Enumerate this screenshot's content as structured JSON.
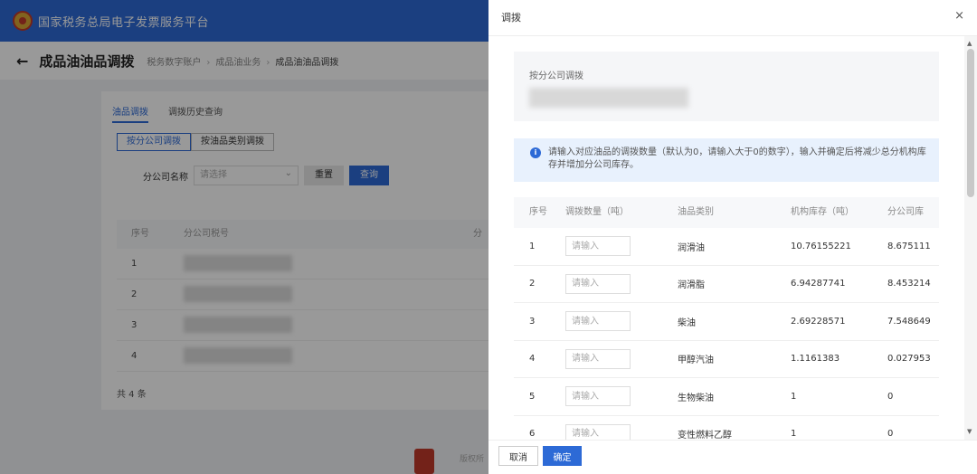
{
  "site": {
    "title": "国家税务总局电子发票服务平台"
  },
  "page": {
    "title": "成品油油品调拨",
    "breadcrumb": [
      "税务数字账户",
      "成品油业务",
      "成品油油品调拨"
    ]
  },
  "tabs": [
    "油品调拨",
    "调拨历史查询"
  ],
  "segments": [
    "按分公司调拨",
    "按油品类别调拨"
  ],
  "filter": {
    "label": "分公司名称",
    "placeholder": "请选择",
    "reset_label": "重置",
    "query_label": "查询"
  },
  "bg_table": {
    "headers": [
      "序号",
      "分公司税号",
      "分"
    ],
    "rows": [
      "1",
      "2",
      "3",
      "4"
    ],
    "total": "共 4 条"
  },
  "footer": {
    "text": "版权所"
  },
  "drawer": {
    "title": "调拨",
    "close": "×",
    "info_label": "按分公司调拨",
    "notice": "请输入对应油品的调拨数量（默认为0，请输入大于0的数字），输入并确定后将减少总分机构库存并增加分公司库存。",
    "notice_icon": "i",
    "headers": [
      "序号",
      "调拨数量（吨）",
      "油品类别",
      "机构库存（吨）",
      "分公司库"
    ],
    "qty_placeholder": "请输入",
    "rows": [
      {
        "no": "1",
        "category": "润滑油",
        "stock": "10.76155221",
        "branch": "8.675111"
      },
      {
        "no": "2",
        "category": "润滑脂",
        "stock": "6.94287741",
        "branch": "8.453214"
      },
      {
        "no": "3",
        "category": "柴油",
        "stock": "2.69228571",
        "branch": "7.548649"
      },
      {
        "no": "4",
        "category": "甲醇汽油",
        "stock": "1.1161383",
        "branch": "0.027953"
      },
      {
        "no": "5",
        "category": "生物柴油",
        "stock": "1",
        "branch": "0"
      },
      {
        "no": "6",
        "category": "变性燃料乙醇",
        "stock": "1",
        "branch": "0"
      }
    ],
    "cancel_label": "取消",
    "ok_label": "确定"
  },
  "scrollbar": {
    "up": "▲",
    "down": "▼"
  },
  "colors": {
    "primary": "#2d6ad6",
    "overlay": "rgba(0,0,0,0.4)"
  }
}
